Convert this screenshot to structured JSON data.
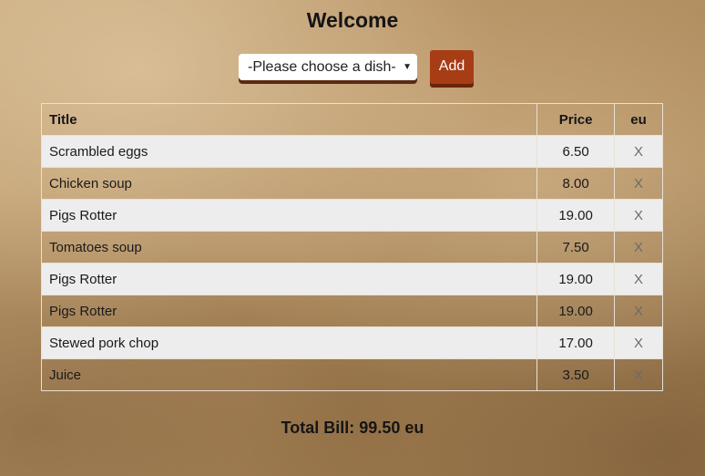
{
  "header": {
    "title": "Welcome"
  },
  "controls": {
    "select_value": "-Please choose a dish-",
    "add_label": "Add"
  },
  "table": {
    "headers": {
      "title": "Title",
      "price": "Price",
      "eu": "eu"
    },
    "rows": [
      {
        "title": "Scrambled eggs",
        "price": "6.50",
        "remove": "X"
      },
      {
        "title": "Chicken soup",
        "price": "8.00",
        "remove": "X"
      },
      {
        "title": "Pigs Rotter",
        "price": "19.00",
        "remove": "X"
      },
      {
        "title": "Tomatoes soup",
        "price": "7.50",
        "remove": "X"
      },
      {
        "title": "Pigs Rotter",
        "price": "19.00",
        "remove": "X"
      },
      {
        "title": "Pigs Rotter",
        "price": "19.00",
        "remove": "X"
      },
      {
        "title": "Stewed pork chop",
        "price": "17.00",
        "remove": "X"
      },
      {
        "title": "Juice",
        "price": "3.50",
        "remove": "X"
      }
    ]
  },
  "footer": {
    "total_text": "Total Bill: 99.50 eu"
  },
  "colors": {
    "accent_button": "#a63d15",
    "row_stripe": "#ededed"
  }
}
